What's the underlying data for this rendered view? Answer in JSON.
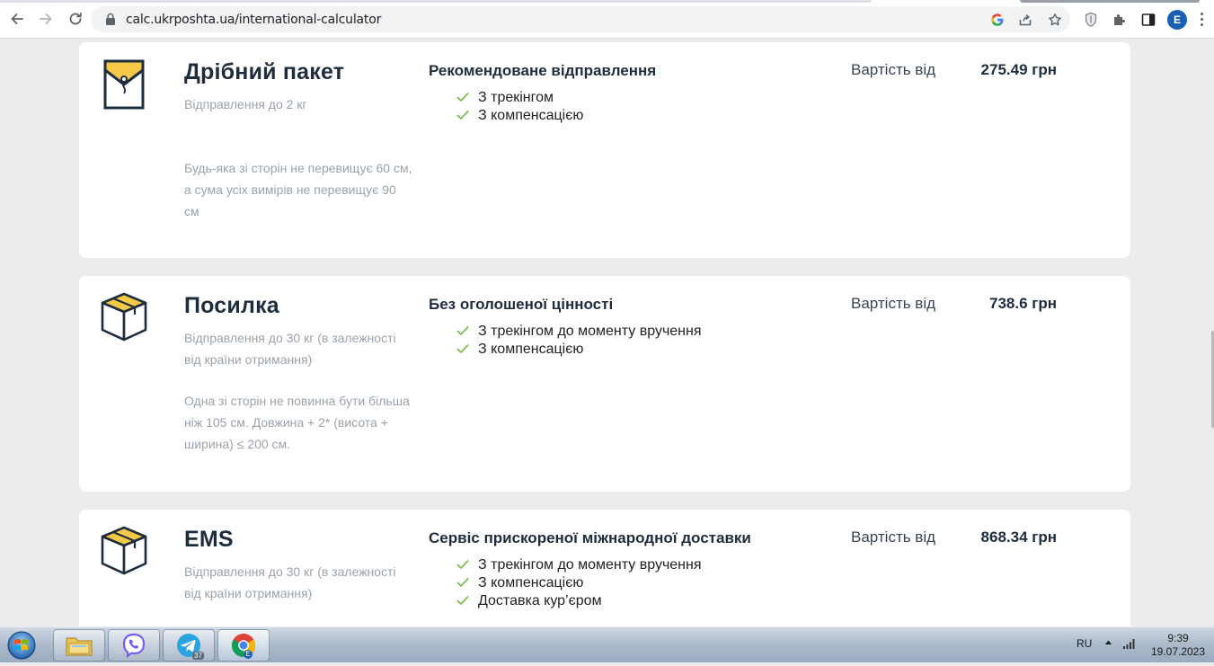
{
  "browser": {
    "url": "calc.ukrposhta.ua/international-calculator",
    "profile_initial": "E"
  },
  "cards": [
    {
      "name": "Дрібний пакет",
      "icon": "envelope-icon",
      "subtitle": "Відправлення до 2 кг",
      "note": "Будь-яка зі сторін не перевищує 60 см, а сума усіх вимірів не перевищує 90 см",
      "service": "Рекомендоване відправлення",
      "features": [
        "З трекінгом",
        "З компенсацією"
      ],
      "price_label": "Вартість від",
      "price": "275.49 грн"
    },
    {
      "name": "Посилка",
      "icon": "box-icon",
      "subtitle": "Відправлення до 30 кг (в залежності від країни отримання)",
      "note": "Одна зі сторін не повинна бути більша ніж 105 см. Довжина + 2* (висота + ширина) ≤ 200 см.",
      "service": "Без оголошеної цінності",
      "features": [
        "З трекінгом до моменту вручення",
        "З компенсацією"
      ],
      "price_label": "Вартість від",
      "price": "738.6 грн"
    },
    {
      "name": "EMS",
      "icon": "box-icon",
      "subtitle": "Відправлення до 30 кг (в залежності від країни отримання)",
      "service": "Сервіс прискореної міжнародної доставки",
      "features": [
        "З трекінгом до моменту вручення",
        "З компенсацією",
        "Доставка кур’єром"
      ],
      "price_label": "Вартість від",
      "price": "868.34 грн"
    }
  ],
  "taskbar": {
    "language": "RU",
    "time": "9:39",
    "date": "19.07.2023",
    "telegram_badge": "37",
    "chrome_badge": "E"
  },
  "colors": {
    "accent_yellow": "#f7c948",
    "navy": "#1e2d3d",
    "check_green": "#7cc04b",
    "page_bg": "#ececec"
  }
}
